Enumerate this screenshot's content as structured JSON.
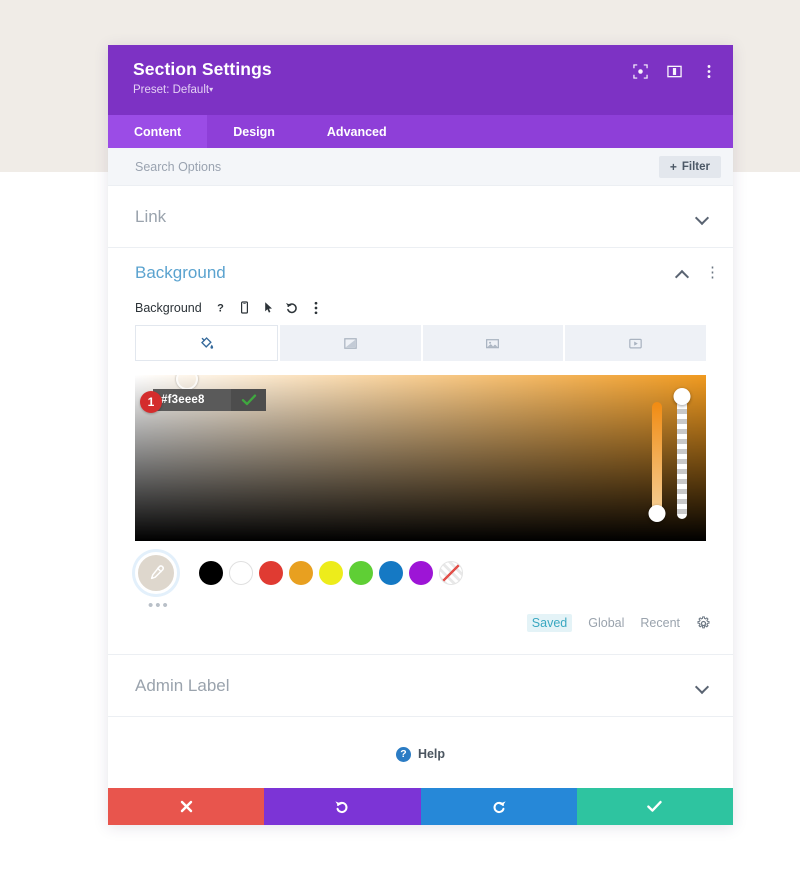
{
  "page": {
    "backdrop_top_color": "#f0ece7",
    "backdrop_bottom_color": "#ffffff"
  },
  "modal": {
    "title": "Section Settings",
    "preset_label": "Preset: Default",
    "preset_caret": "▾",
    "header_color": "#7d32c4",
    "header_icons": [
      {
        "name": "fullscreen-icon"
      },
      {
        "name": "layout-columns-icon"
      },
      {
        "name": "more-vertical-icon"
      }
    ]
  },
  "tabs": [
    {
      "label": "Content",
      "active": true
    },
    {
      "label": "Design",
      "active": false
    },
    {
      "label": "Advanced",
      "active": false
    }
  ],
  "search": {
    "placeholder": "Search Options",
    "value": "",
    "filter_label": "Filter",
    "filter_plus": "+"
  },
  "sections": {
    "link": {
      "title": "Link",
      "expanded": false
    },
    "background": {
      "title": "Background",
      "expanded": true,
      "accent_color": "#5ba3cf",
      "kebab": "⋮",
      "field_label": "Background",
      "field_icons": [
        {
          "name": "help-question-icon",
          "glyph": "?"
        },
        {
          "name": "responsive-phone-icon"
        },
        {
          "name": "hover-cursor-icon"
        },
        {
          "name": "reset-undo-icon"
        },
        {
          "name": "more-options-icon"
        }
      ],
      "bg_types": [
        {
          "name": "bg-color-tab",
          "icon": "paint-bucket-icon",
          "active": true
        },
        {
          "name": "bg-gradient-tab",
          "icon": "gradient-icon",
          "active": false
        },
        {
          "name": "bg-image-tab",
          "icon": "image-icon",
          "active": false
        },
        {
          "name": "bg-video-tab",
          "icon": "video-icon",
          "active": false
        }
      ]
    },
    "admin_label": {
      "title": "Admin Label",
      "expanded": false
    }
  },
  "color_picker": {
    "hex_value": "#f3eee8",
    "hex_placeholder": "#ffffff",
    "confirm_icon": "check-icon",
    "confirm_color": "#3fa83f",
    "step_badge": "1",
    "badge_color": "#d42c2c",
    "base_hue_color": "#f09a20",
    "hue_slider": {
      "top_color": "#f18b12",
      "bottom_color": "#f5cf96"
    },
    "eyedropper": {
      "name": "eyedropper-icon",
      "swatch_color": "#ded7cd"
    },
    "more_swatches": "•••",
    "swatches": [
      {
        "name": "swatch-black",
        "color": "#000000"
      },
      {
        "name": "swatch-white",
        "color": "#ffffff"
      },
      {
        "name": "swatch-red",
        "color": "#e03b32"
      },
      {
        "name": "swatch-orange",
        "color": "#e8a020"
      },
      {
        "name": "swatch-yellow",
        "color": "#edec1b"
      },
      {
        "name": "swatch-green",
        "color": "#5fcf35"
      },
      {
        "name": "swatch-blue",
        "color": "#1579c4"
      },
      {
        "name": "swatch-purple",
        "color": "#9d15d6"
      },
      {
        "name": "swatch-none",
        "color": "transparent"
      }
    ],
    "palette_tabs": [
      {
        "label": "Saved",
        "active": true
      },
      {
        "label": "Global",
        "active": false
      },
      {
        "label": "Recent",
        "active": false
      }
    ],
    "settings_icon": "gear-icon"
  },
  "help": {
    "label": "Help",
    "icon_glyph": "?"
  },
  "footer": [
    {
      "name": "cancel-button",
      "icon": "close-x-icon",
      "color": "#e8554d"
    },
    {
      "name": "undo-button",
      "icon": "undo-arrow-icon",
      "color": "#7c34d6"
    },
    {
      "name": "redo-button",
      "icon": "redo-arrow-icon",
      "color": "#2688d8"
    },
    {
      "name": "save-button",
      "icon": "check-icon",
      "color": "#2ec4a0"
    }
  ]
}
